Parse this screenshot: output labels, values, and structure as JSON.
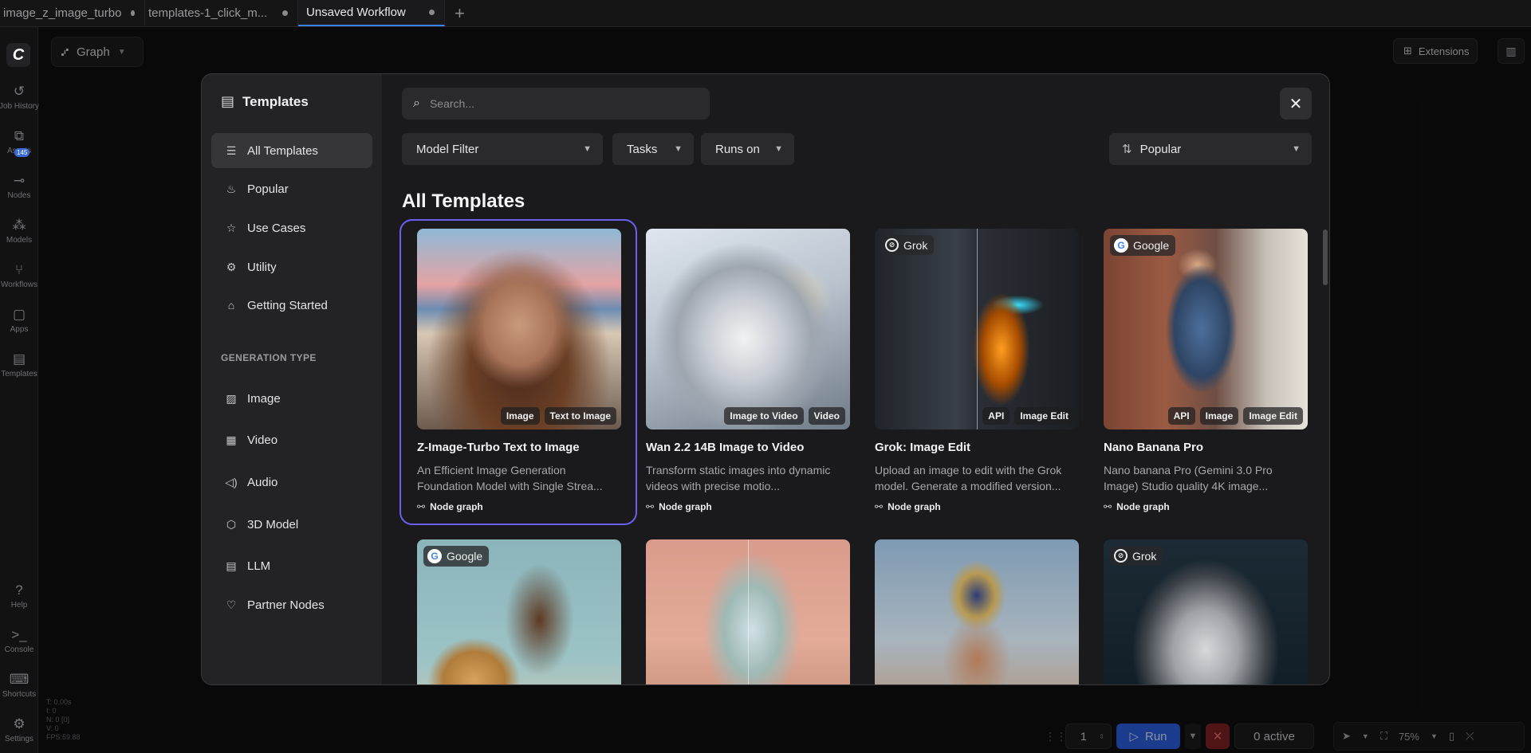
{
  "tabs": [
    {
      "label": "image_z_image_turbo"
    },
    {
      "label": "templates-1_click_m..."
    },
    {
      "label": "Unsaved Workflow"
    }
  ],
  "rail": {
    "items": [
      {
        "label": "Job History",
        "icon": "history-icon"
      },
      {
        "label": "Assets",
        "icon": "assets-icon",
        "badge": "145"
      },
      {
        "label": "Nodes",
        "icon": "nodes-icon"
      },
      {
        "label": "Models",
        "icon": "models-icon"
      },
      {
        "label": "Workflows",
        "icon": "workflows-icon"
      },
      {
        "label": "Apps",
        "icon": "apps-icon"
      },
      {
        "label": "Templates",
        "icon": "templates-icon"
      },
      {
        "label": "Help",
        "icon": "help-icon"
      },
      {
        "label": "Console",
        "icon": "console-icon"
      },
      {
        "label": "Shortcuts",
        "icon": "keyboard-icon"
      },
      {
        "label": "Settings",
        "icon": "gear-icon"
      }
    ],
    "stats": [
      "T: 0.00s",
      "I: 0",
      "N: 0 [0]",
      "V: 0",
      "FPS:59.88"
    ]
  },
  "header": {
    "graph_label": "Graph",
    "extensions_label": "Extensions"
  },
  "runbar": {
    "quantity": "1",
    "run_label": "Run",
    "active_label": "0 active"
  },
  "canvas_tools": {
    "zoom": "75%"
  },
  "modal": {
    "title": "Templates",
    "nav": [
      {
        "label": "All Templates",
        "selected": true
      },
      {
        "label": "Popular"
      },
      {
        "label": "Use Cases"
      },
      {
        "label": "Utility"
      },
      {
        "label": "Getting Started"
      }
    ],
    "generation_type_label": "GENERATION TYPE",
    "generation_types": [
      {
        "label": "Image"
      },
      {
        "label": "Video"
      },
      {
        "label": "Audio"
      },
      {
        "label": "3D Model"
      },
      {
        "label": "LLM"
      },
      {
        "label": "Partner Nodes"
      }
    ],
    "search_placeholder": "Search...",
    "filters": {
      "model": "Model Filter",
      "tasks": "Tasks",
      "runs_on": "Runs on",
      "sort": "Popular"
    },
    "heading": "All Templates",
    "cards": [
      {
        "title": "Z-Image-Turbo Text to Image",
        "desc": "An Efficient Image Generation Foundation Model with Single Strea...",
        "kind": "Node graph",
        "tags": [
          "Image",
          "Text to Image"
        ],
        "brand": ""
      },
      {
        "title": "Wan 2.2 14B Image to Video",
        "desc": "Transform static images into dynamic videos with precise motio...",
        "kind": "Node graph",
        "tags": [
          "Image to Video",
          "Video"
        ],
        "brand": ""
      },
      {
        "title": "Grok: Image Edit",
        "desc": "Upload an image to edit with the Grok model. Generate a modified version...",
        "kind": "Node graph",
        "tags": [
          "API",
          "Image Edit"
        ],
        "brand": "Grok"
      },
      {
        "title": "Nano Banana Pro",
        "desc": "Nano banana Pro (Gemini 3.0 Pro Image) Studio quality 4K image...",
        "kind": "Node graph",
        "tags": [
          "API",
          "Image",
          "Image Edit"
        ],
        "brand": "Google"
      }
    ],
    "row2_brands": [
      "Google",
      "",
      "",
      "Grok"
    ]
  }
}
